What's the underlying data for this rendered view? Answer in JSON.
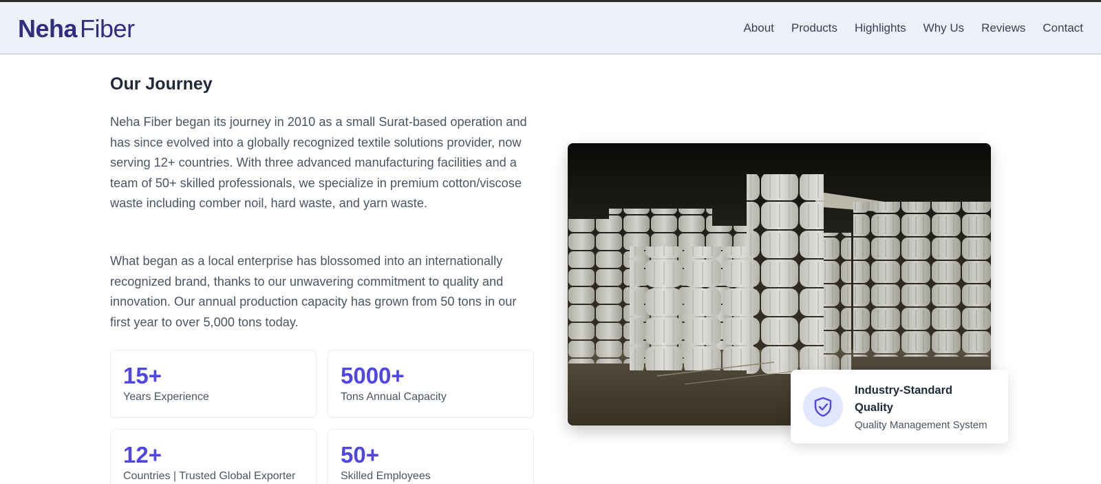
{
  "header": {
    "brand_bold": "Neha",
    "brand_light": "Fiber",
    "nav": [
      "About",
      "Products",
      "Highlights",
      "Why Us",
      "Reviews",
      "Contact"
    ]
  },
  "journey": {
    "title": "Our Journey",
    "paragraph_1": "Neha Fiber began its journey in 2010 as a small Surat-based operation and has since evolved into a globally recognized textile solutions provider, now serving 12+ countries. With three advanced manufacturing facilities and a team of 50+ skilled professionals, we specialize in premium cotton/viscose waste including comber noil, hard waste, and yarn waste.",
    "paragraph_2": "What began as a local enterprise has blossomed into an internationally recognized brand, thanks to our unwavering commitment to quality and innovation. Our annual production capacity has grown from 50 tons in our first year to over 5,000 tons today."
  },
  "stats": [
    {
      "value": "15+",
      "label": "Years Experience"
    },
    {
      "value": "5000+",
      "label": "Tons Annual Capacity"
    },
    {
      "value": "12+",
      "label": "Countries | Trusted Global Exporter"
    },
    {
      "value": "50+",
      "label": "Skilled Employees"
    }
  ],
  "badge": {
    "icon": "shield-check-icon",
    "title": "Industry-Standard Quality",
    "subtitle": "Quality Management System"
  },
  "colors": {
    "accent": "#4f46e5",
    "brand": "#312e81",
    "header_bg": "#eef0fc"
  }
}
